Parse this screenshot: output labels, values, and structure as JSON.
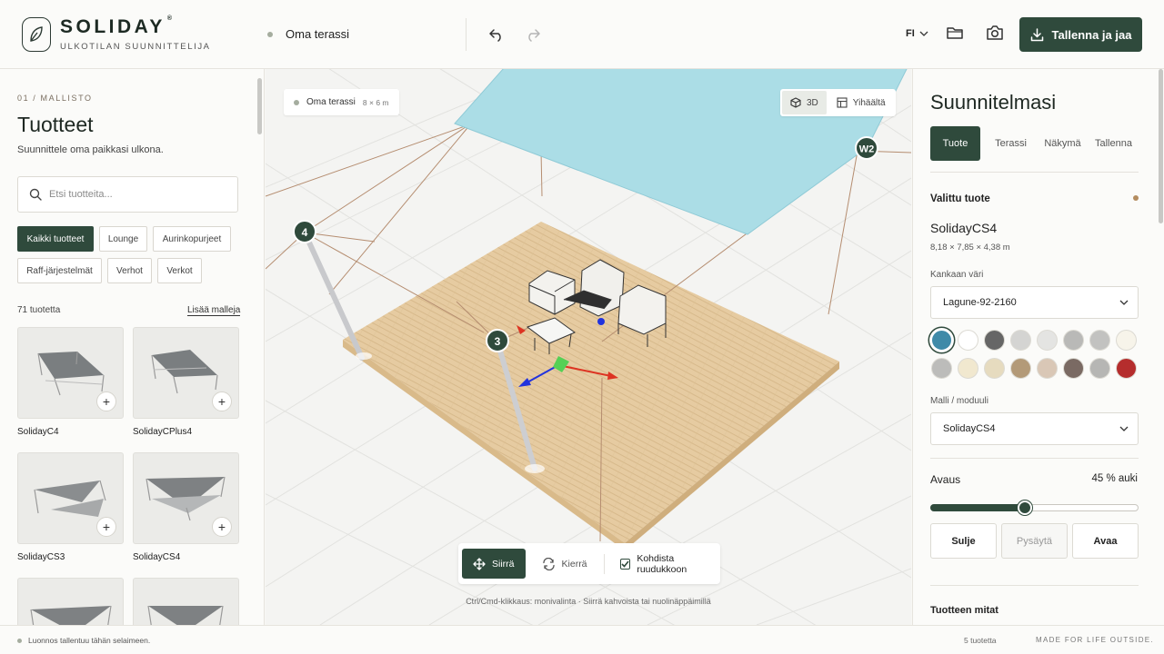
{
  "header": {
    "brand": "SOLIDAY",
    "brand_mark": "®",
    "subtitle": "ULKOTILAN SUUNNITTELIJA",
    "project_name": "Oma terassi",
    "language": "FI",
    "save_label": "Tallenna ja jaa"
  },
  "left": {
    "step": "01 / MALLISTO",
    "title": "Tuotteet",
    "subtitle": "Suunnittele oma paikkasi ulkona.",
    "search_placeholder": "Etsi tuotteita...",
    "filters": [
      "Kaikki tuotteet",
      "Lounge",
      "Aurinkopurjeet",
      "Raff-järjestelmät",
      "Verhot",
      "Verkot"
    ],
    "active_filter": "Kaikki tuotteet",
    "count": "71 tuotetta",
    "more_link": "Lisää malleja",
    "products": [
      {
        "name": "SolidayC4"
      },
      {
        "name": "SolidayCPlus4"
      },
      {
        "name": "SolidayCS3"
      },
      {
        "name": "SolidayCS4"
      }
    ]
  },
  "viewport": {
    "tag_name": "Oma terassi",
    "tag_dims": "8 × 6 m",
    "view_3d": "3D",
    "view_top": "Yihäältä",
    "tool_move": "Siirrä",
    "tool_rotate": "Kierrä",
    "snap_label": "Kohdista ruudukkoon",
    "snap_checked": true,
    "hint": "Ctrl/Cmd-klikkaus: monivalinta · Siirrä kahvoista tai nuolinäppäimillä",
    "post_markers": [
      "4",
      "3",
      "W2"
    ]
  },
  "right": {
    "title": "Suunnitelmasi",
    "tabs": [
      "Tuote",
      "Terassi",
      "Näkymä",
      "Tallenna"
    ],
    "active_tab": "Tuote",
    "selected_label": "Valittu tuote",
    "product_name": "SolidayCS4",
    "product_dims": "8,18 × 7,85 × 4,38 m",
    "fabric_label": "Kankaan väri",
    "fabric_value": "Lagune-92-2160",
    "swatches": [
      "#3f8aa8",
      "#ffffff",
      "#666666",
      "#d4d4d2",
      "#e4e4e2",
      "#b9b9b7",
      "#c2c2c0",
      "#f7f4ea",
      "#bcbcba",
      "#f1e8cf",
      "#e6dbbf",
      "#b39a78",
      "#d9c7b6",
      "#7a6a63",
      "#b6b6b4",
      "#b52d2d"
    ],
    "selected_swatch_index": 0,
    "model_label": "Malli / moduuli",
    "model_value": "SolidayCS4",
    "opening_label": "Avaus",
    "opening_value": "45 % auki",
    "opening_fraction": 0.45,
    "btn_close": "Sulje",
    "btn_stop": "Pysäytä",
    "btn_open": "Avaa",
    "dimensions_label": "Tuotteen mitat"
  },
  "footer": {
    "status": "Luonnos tallentuu tähän selaimeen.",
    "count": "5 tuotetta",
    "tagline": "MADE FOR LIFE OUTSIDE."
  },
  "colors": {
    "accent": "#2f4a3c",
    "sail": "#a9dbe4",
    "deck": "#e4c9a0"
  }
}
